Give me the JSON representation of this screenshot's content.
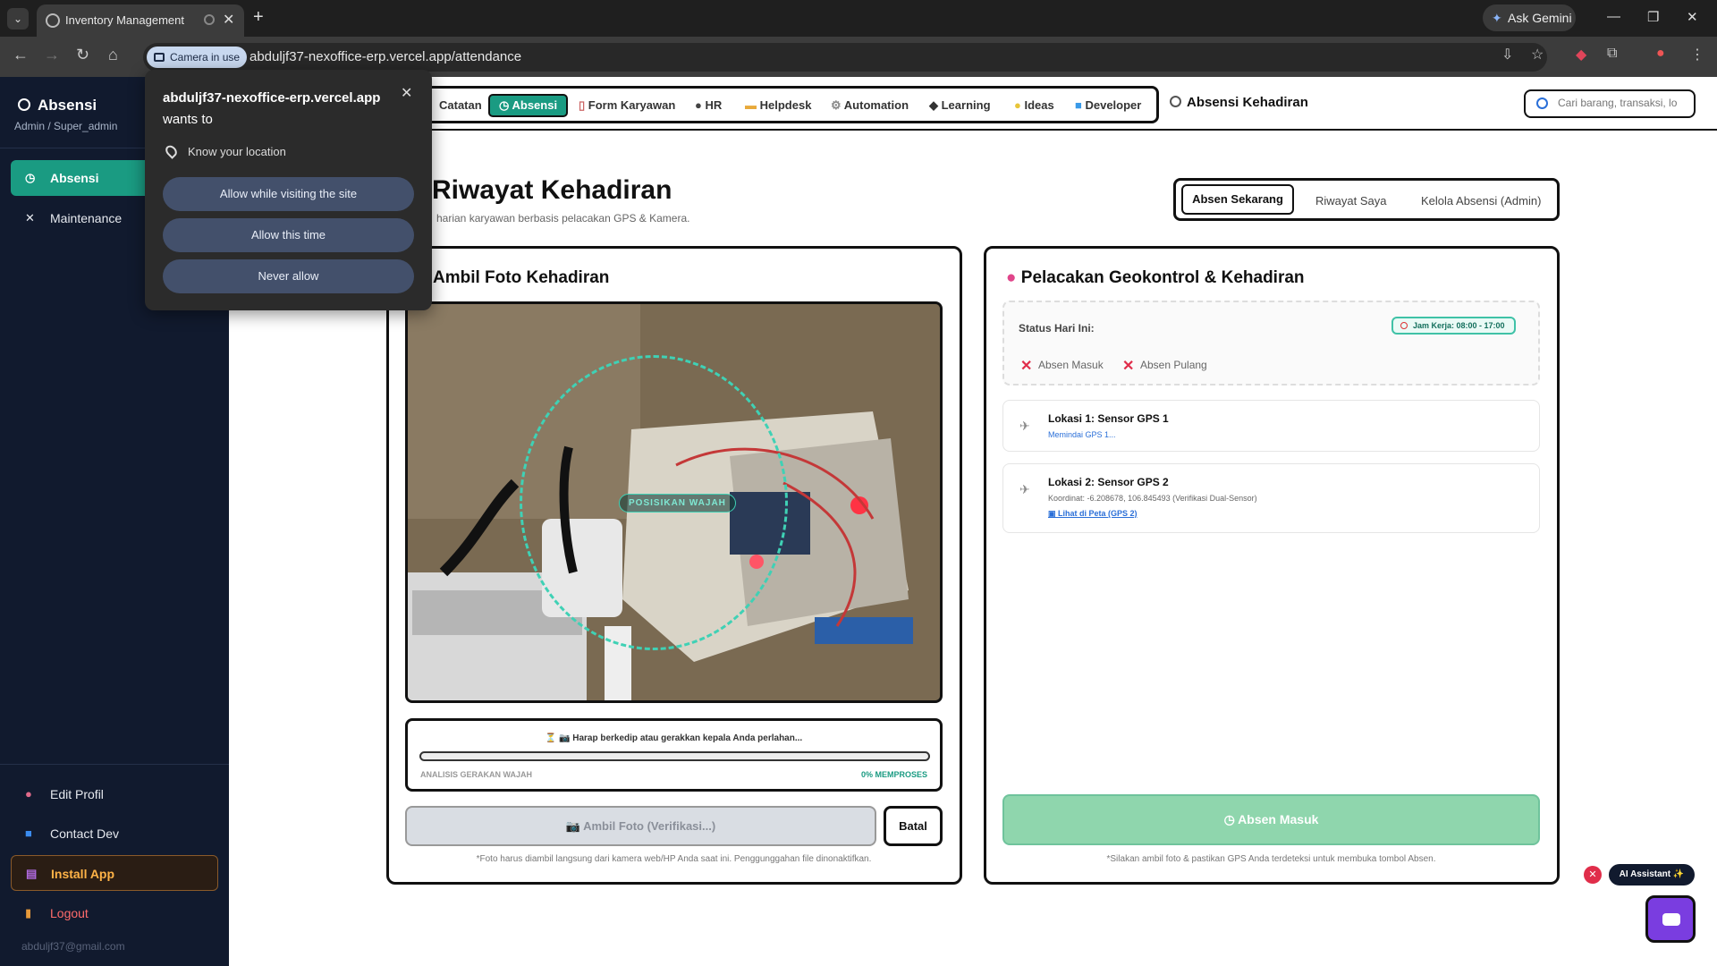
{
  "browser": {
    "tab_title": "Inventory Management",
    "new_tab": "+",
    "ask_gemini": "Ask Gemini",
    "camera_chip": "Camera in use",
    "url": "abduljf37-nexoffice-erp.vercel.app/attendance"
  },
  "permission_popup": {
    "site": "abduljf37-nexoffice-erp.vercel.app",
    "wants_to": "wants to",
    "permission": "Know your location",
    "allow_visiting": "Allow while visiting the site",
    "allow_once": "Allow this time",
    "never": "Never allow"
  },
  "sidebar": {
    "title": "Absensi",
    "role": "Admin / Super_admin",
    "items": [
      {
        "label": "Absensi",
        "icon": "clock-icon"
      },
      {
        "label": "Maintenance",
        "icon": "tools-icon"
      }
    ],
    "bottom": [
      {
        "label": "Edit Profil",
        "icon": "user-icon"
      },
      {
        "label": "Contact Dev",
        "icon": "info-icon"
      },
      {
        "label": "Install App",
        "icon": "install-icon"
      },
      {
        "label": "Logout",
        "icon": "logout-icon"
      }
    ],
    "email": "abduljf37@gmail.com"
  },
  "modules": [
    "Catatan",
    "Absensi",
    "Form Karyawan",
    "HR",
    "Helpdesk",
    "Automation",
    "Learning",
    "Ideas",
    "Developer"
  ],
  "header": {
    "page_title": "Absensi Kehadiran",
    "search_placeholder": "Cari barang, transaksi, lo"
  },
  "main": {
    "title": "Riwayat Kehadiran",
    "subtitle": "harian karyawan berbasis pelacakan GPS & Kamera.",
    "tabs": [
      "Absen Sekarang",
      "Riwayat Saya",
      "Kelola Absensi (Admin)"
    ]
  },
  "photo_card": {
    "title": "Ambil Foto Kehadiran",
    "scan_label": "POSISIKAN WAJAH",
    "progress_msg": "⏳ 📷 Harap berkedip atau gerakkan kepala Anda perlahan...",
    "progress_label": "ANALISIS GERAKAN WAJAH",
    "progress_status": "0% MEMPROSES",
    "progress_fraction": 0,
    "btn_photo": "📷 Ambil Foto (Verifikasi...)",
    "btn_cancel": "Batal",
    "note": "*Foto harus diambil langsung dari kamera web/HP Anda saat ini. Penggunggahan file dinonaktifkan."
  },
  "geo_card": {
    "title": "Pelacakan Geokontrol & Kehadiran",
    "status_label": "Status Hari Ini:",
    "work_hours": "Jam Kerja: 08:00 - 17:00",
    "check_in": "Absen Masuk",
    "check_out": "Absen Pulang",
    "gps1_title": "Lokasi 1: Sensor GPS 1",
    "gps1_status": "Memindai GPS 1...",
    "gps2_title": "Lokasi 2: Sensor GPS 2",
    "gps2_coords": "Koordinat: -6.208678, 106.845493 (Verifikasi Dual-Sensor)",
    "gps2_link": "Lihat di Peta (GPS 2)",
    "btn_masuk": "Absen Masuk",
    "note": "*Silakan ambil foto & pastikan GPS Anda terdeteksi untuk membuka tombol Absen."
  },
  "assistant": {
    "label": "AI Assistant ✨"
  }
}
